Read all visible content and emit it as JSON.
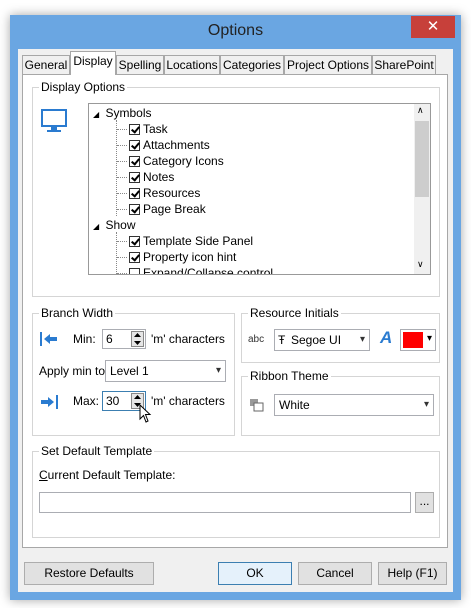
{
  "window": {
    "title": "Options",
    "close_glyph": "✕"
  },
  "tabs": [
    {
      "label": "General"
    },
    {
      "label": "Display"
    },
    {
      "label": "Spelling"
    },
    {
      "label": "Locations"
    },
    {
      "label": "Categories"
    },
    {
      "label": "Project Options"
    },
    {
      "label": "SharePoint"
    }
  ],
  "display_options": {
    "label": "Display Options",
    "icon": "monitor-icon",
    "tree": [
      {
        "label": "Symbols",
        "type": "group"
      },
      {
        "label": "Task",
        "checked": true
      },
      {
        "label": "Attachments",
        "checked": true
      },
      {
        "label": "Category Icons",
        "checked": true
      },
      {
        "label": "Notes",
        "checked": true
      },
      {
        "label": "Resources",
        "checked": true
      },
      {
        "label": "Page Break",
        "checked": true
      },
      {
        "label": "Show",
        "type": "group"
      },
      {
        "label": "Template Side Panel",
        "checked": true
      },
      {
        "label": "Property icon hint",
        "checked": true
      },
      {
        "label": "Expand/Collapse control",
        "checked": false
      }
    ]
  },
  "branch_width": {
    "label": "Branch Width",
    "min_label": "Min:",
    "min_value": "6",
    "min_units": "'m' characters",
    "apply_label": "Apply min to:",
    "apply_value": "Level 1",
    "max_label": "Max:",
    "max_value": "30",
    "max_units": "'m' characters"
  },
  "resource_initials": {
    "label": "Resource Initials",
    "abc_text": "abc",
    "font_glyph": "Ŧ",
    "font_value": "Segoe UI",
    "color_hex": "#ff0000",
    "font_color_glyph": "A"
  },
  "ribbon_theme": {
    "label": "Ribbon Theme",
    "value": "White"
  },
  "default_template": {
    "label": "Set Default Template",
    "current_label_first": "C",
    "current_label_rest": "urrent Default Template:",
    "path_value": "",
    "browse_label": "..."
  },
  "buttons": {
    "restore": "Restore Defaults",
    "ok": "OK",
    "cancel": "Cancel",
    "help": "Help (F1)"
  },
  "colors": {
    "accent": "#6aa6e2",
    "close": "#c7403a",
    "icon_blue": "#2a7bd0"
  }
}
